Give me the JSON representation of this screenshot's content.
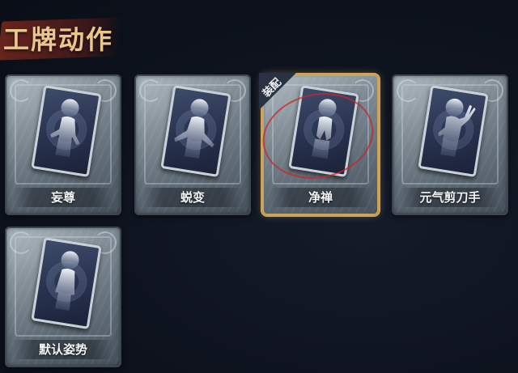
{
  "header": {
    "title": "工牌动作"
  },
  "cards": [
    {
      "label": "妄尊",
      "equipped": false,
      "pose": "hand-on-hip"
    },
    {
      "label": "蜕变",
      "equipped": false,
      "pose": "arms-open"
    },
    {
      "label": "净禅",
      "equipped": true,
      "pose": "prayer"
    },
    {
      "label": "元气剪刀手",
      "equipped": false,
      "pose": "peace-sign"
    },
    {
      "label": "默认姿势",
      "equipped": false,
      "pose": "default"
    }
  ],
  "badge": {
    "equipped_label": "装配"
  },
  "colors": {
    "accent_gold": "#c9a45a",
    "title_text": "#e9c78f",
    "title_ribbon": "#7a281e",
    "background": "#0e1420",
    "selection_ring": "#c82828"
  }
}
